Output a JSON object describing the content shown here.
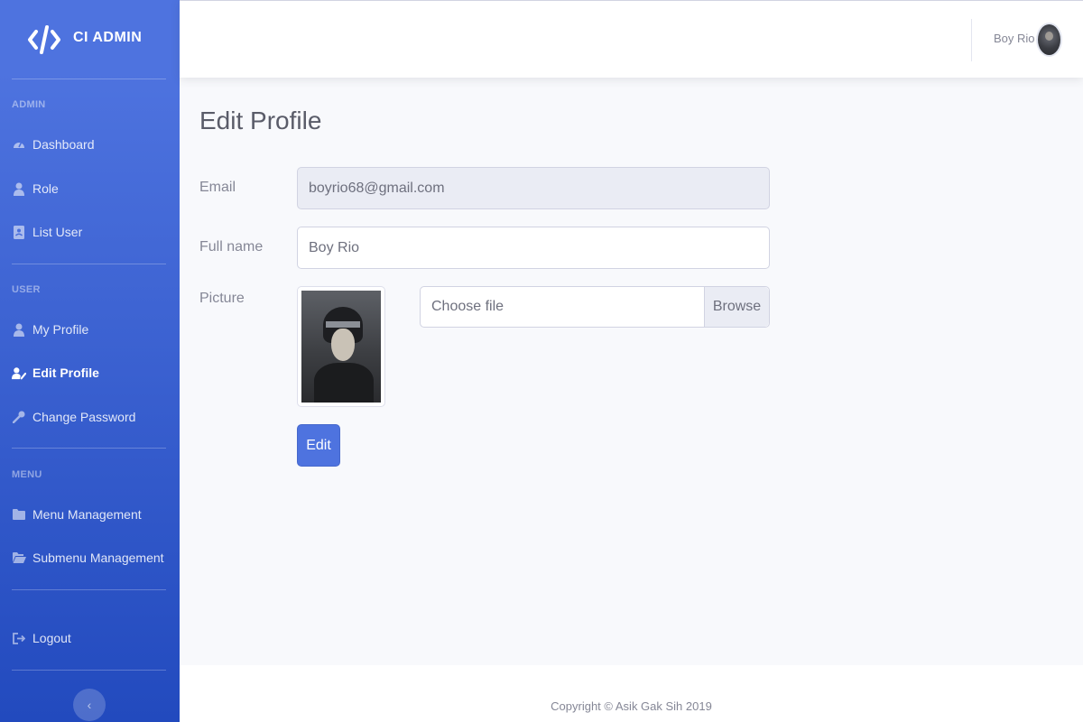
{
  "brand": {
    "name": "CI ADMIN",
    "icon": "code-brackets-icon"
  },
  "sidebar": {
    "headings": {
      "admin": "ADMIN",
      "user": "USER",
      "menu": "MENU"
    },
    "admin_items": [
      {
        "label": "Dashboard",
        "icon": "tachometer-icon"
      },
      {
        "label": "Role",
        "icon": "user-tie-icon"
      },
      {
        "label": "List User",
        "icon": "address-book-icon"
      }
    ],
    "user_items": [
      {
        "label": "My Profile",
        "icon": "user-icon"
      },
      {
        "label": "Edit Profile",
        "icon": "user-edit-icon",
        "active": true
      },
      {
        "label": "Change Password",
        "icon": "key-icon"
      }
    ],
    "menu_items": [
      {
        "label": "Menu Management",
        "icon": "folder-icon"
      },
      {
        "label": "Submenu Management",
        "icon": "folder-open-icon"
      }
    ],
    "logout": {
      "label": "Logout",
      "icon": "sign-out-icon"
    },
    "toggle": {
      "icon": "chevron-left-icon",
      "glyph": "‹"
    }
  },
  "topbar": {
    "user_name": "Boy Rio"
  },
  "page": {
    "title": "Edit Profile",
    "form": {
      "email_label": "Email",
      "email_value": "boyrio68@gmail.com",
      "fullname_label": "Full name",
      "fullname_value": "Boy Rio",
      "picture_label": "Picture",
      "file_placeholder": "Choose file",
      "browse_label": "Browse",
      "submit_label": "Edit"
    }
  },
  "footer": {
    "copyright": "Copyright © Asik Gak Sih 2019"
  },
  "colors": {
    "primary": "#4e73df",
    "primary_dark": "#224abe",
    "background": "#f8f9fc",
    "text": "#858796",
    "heading_text": "#5a5c69"
  }
}
